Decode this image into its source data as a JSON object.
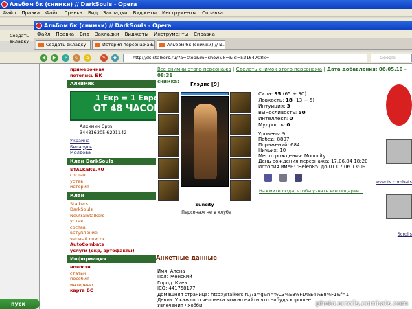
{
  "window1": {
    "title": "Альбом бк (снимки) // DarkSouls - Opera",
    "menu": [
      "Файл",
      "Правка",
      "Файл",
      "Правка",
      "Вид",
      "Закладки",
      "Виджеты",
      "Инструменты",
      "Справка"
    ]
  },
  "window2": {
    "title": "Альбом бк (снимки) // DarkSouls - Opera",
    "menu": [
      "Файл",
      "Правка",
      "Вид",
      "Закладки",
      "Виджеты",
      "Инструменты",
      "Справка"
    ]
  },
  "tabs": [
    "Создать вкладку",
    "История персонажа БК ...",
    "Альбом бк (снимки) // D..."
  ],
  "address": "http://ds.stalkers.ru/?a=stop&m=show&k=&id=52164708k=",
  "search_placeholder": "Google",
  "sidebar": {
    "top_links": [
      "примерочная",
      "петопись БК"
    ],
    "alchemist_title": "Алхимик",
    "banner": {
      "line1": "1 Екр = 1 Евро",
      "line2": "ОТ 48 ЧАСОВ"
    },
    "alchemist_names": "Алхимик  Cptn",
    "alchemist_icq": "344816305  6291142",
    "countries": [
      "Украина",
      "Беларусь",
      "Молдова"
    ],
    "clan_title": "Клан DarkSouls",
    "stalkers": "STALKERS.RU",
    "clan_links": [
      "состав",
      "устав",
      "история"
    ],
    "clan2_title": "Клан",
    "clan2_links": [
      "Stalkers",
      "DarkSouls",
      "NeutralStalkers",
      "устав",
      "состав",
      "вступление",
      "черный список",
      "AutoCombats",
      "услуги (екр, артефакты)"
    ],
    "info_title": "Информация",
    "info_links": [
      "новости",
      "статьи",
      "пособия",
      "интервью",
      "карта БС"
    ]
  },
  "main": {
    "top_links": [
      "Все снимки этого персонажа",
      "Сделать снимок этого персонажа"
    ],
    "date_label": "Дата добавления: 06.05.10 - 08:31",
    "snapshot_label": "снимка:",
    "char_name": "Глэдис [9]",
    "stats": [
      {
        "k": "Сила:",
        "v": "95",
        "x": "(65 + 30)"
      },
      {
        "k": "Ловкость:",
        "v": "18",
        "x": "(13 + 5)"
      },
      {
        "k": "Интуиция:",
        "v": "3",
        "x": ""
      },
      {
        "k": "Выносливость:",
        "v": "50",
        "x": ""
      },
      {
        "k": "Интеллект:",
        "v": "0",
        "x": ""
      },
      {
        "k": "Мудрость:",
        "v": "0",
        "x": ""
      }
    ],
    "stats2": [
      "Уровень: 9",
      "Побед: 8897",
      "Поражений: 684",
      "Ничьих: 10",
      "Место рождения: Mooncity",
      "День рождения персонажа: 17.06.04 18:20",
      "История имен: 'Helen85' до 01.07.06 13:09"
    ],
    "find_link": "Нажмите сюда, чтобы узнать все подарки...",
    "caption": "Suncity",
    "caption2": "Персонаж не в клубе",
    "anket_title": "Анкетные данные",
    "info": [
      "Имя: Алена",
      "Пол: Женский",
      "Город: Киев",
      "ICQ: 441758177",
      "Домашняя страница: http://stalkers.ru/?a=g&n=%C3%EB%FD%E4%E8%F1&f=1",
      "Девиз: У каждого человека можно найти что нибудь хорошее...",
      "Увлечения / хобби:"
    ]
  },
  "right": {
    "events": "events.combats",
    "scrolls": "Scrolls"
  },
  "taskbar": "пуск",
  "watermark": "photo.scrolls.combats.com"
}
